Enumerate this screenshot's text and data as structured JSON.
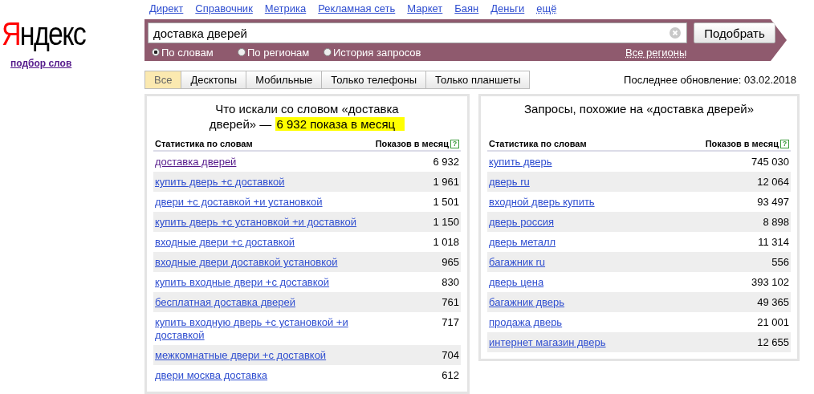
{
  "logo": {
    "text": "Яндекс",
    "subtitle": "подбор слов"
  },
  "nav": [
    {
      "label": "Директ",
      "kind": "link"
    },
    {
      "label": "Справочник",
      "kind": "link"
    },
    {
      "label": "Метрика",
      "kind": "link"
    },
    {
      "label": "Рекламная сеть",
      "kind": "link"
    },
    {
      "label": "Маркет",
      "kind": "link"
    },
    {
      "label": "Баян",
      "kind": "link"
    },
    {
      "label": "Деньги",
      "kind": "link"
    },
    {
      "label": "ещё",
      "kind": "dropdown"
    }
  ],
  "search": {
    "value": "доставка дверей",
    "button": "Подобрать",
    "region": "Все регионы",
    "modes": [
      {
        "label": "По словам",
        "selected": true
      },
      {
        "label": "По регионам",
        "selected": false
      },
      {
        "label": "История запросов",
        "selected": false
      }
    ]
  },
  "tabs": [
    {
      "label": "Все",
      "selected": true
    },
    {
      "label": "Десктопы",
      "selected": false
    },
    {
      "label": "Мобильные",
      "selected": false
    },
    {
      "label": "Только телефоны",
      "selected": false
    },
    {
      "label": "Только планшеты",
      "selected": false
    }
  ],
  "last_update": "Последнее обновление: 03.02.2018",
  "panels": [
    {
      "title": "Что искали со словом «доставка дверей» — ",
      "highlight": "6 932 показа в месяц",
      "columns": [
        "Статистика по словам",
        "Показов в месяц"
      ],
      "help": "?",
      "rows": [
        {
          "phrase": "доставка дверей",
          "count": "6 932",
          "visited": true
        },
        {
          "phrase": "купить дверь +с доставкой",
          "count": "1 961",
          "visited": false
        },
        {
          "phrase": "двери +с доставкой +и установкой",
          "count": "1 501",
          "visited": false
        },
        {
          "phrase": "купить дверь +с установкой +и доставкой",
          "count": "1 150",
          "visited": false
        },
        {
          "phrase": "входные двери +с доставкой",
          "count": "1 018",
          "visited": false
        },
        {
          "phrase": "входные двери доставкой установкой",
          "count": "965",
          "visited": false
        },
        {
          "phrase": "купить входные двери +с доставкой",
          "count": "830",
          "visited": false
        },
        {
          "phrase": "бесплатная доставка дверей",
          "count": "761",
          "visited": false
        },
        {
          "phrase": "купить входную дверь +с установкой +и доставкой",
          "count": "717",
          "visited": false
        },
        {
          "phrase": "межкомнатные двери +с доставкой",
          "count": "704",
          "visited": false
        },
        {
          "phrase": "двери москва доставка",
          "count": "612",
          "visited": false
        }
      ]
    },
    {
      "title": "Запросы, похожие на «доставка дверей»",
      "columns": [
        "Статистика по словам",
        "Показов в месяц"
      ],
      "help": "?",
      "rows": [
        {
          "phrase": "купить дверь",
          "count": "745 030",
          "visited": false
        },
        {
          "phrase": "дверь ru",
          "count": "12 064",
          "visited": false
        },
        {
          "phrase": "входной дверь купить",
          "count": "93 497",
          "visited": false
        },
        {
          "phrase": "дверь россия",
          "count": "8 898",
          "visited": false
        },
        {
          "phrase": "дверь металл",
          "count": "11 314",
          "visited": false
        },
        {
          "phrase": "багажник ru",
          "count": "556",
          "visited": false
        },
        {
          "phrase": "дверь цена",
          "count": "393 102",
          "visited": false
        },
        {
          "phrase": "багажник дверь",
          "count": "49 365",
          "visited": false
        },
        {
          "phrase": "продажа дверь",
          "count": "21 001",
          "visited": false
        },
        {
          "phrase": "интернет магазин дверь",
          "count": "12 655",
          "visited": false
        }
      ]
    }
  ]
}
